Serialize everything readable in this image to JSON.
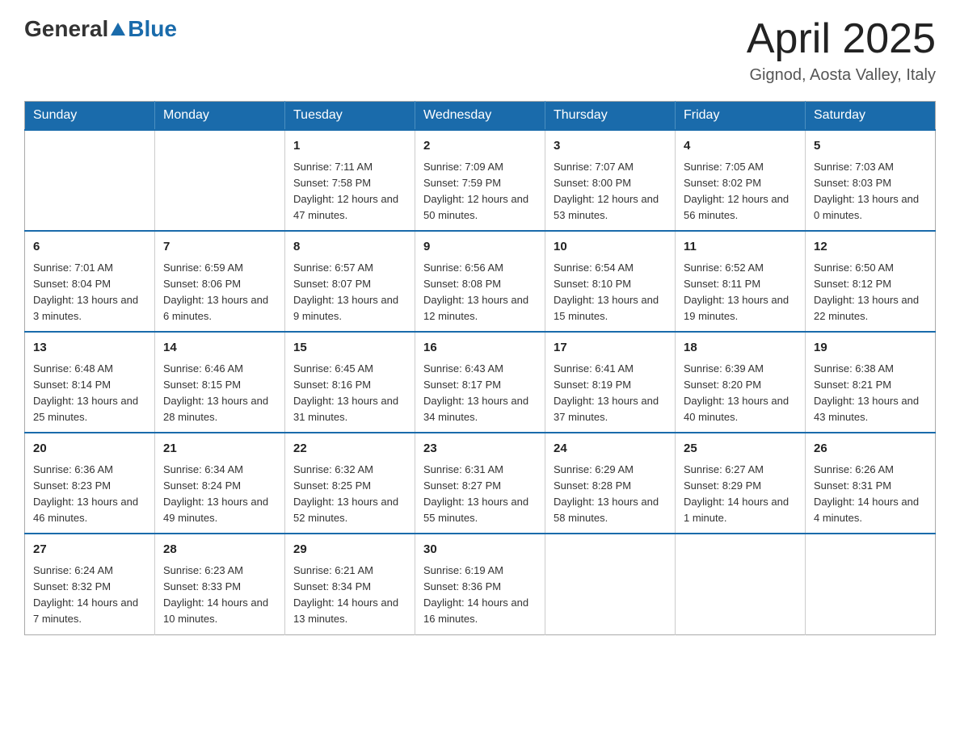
{
  "header": {
    "logo_general": "General",
    "logo_blue": "Blue",
    "title": "April 2025",
    "subtitle": "Gignod, Aosta Valley, Italy"
  },
  "days_of_week": [
    "Sunday",
    "Monday",
    "Tuesday",
    "Wednesday",
    "Thursday",
    "Friday",
    "Saturday"
  ],
  "weeks": [
    [
      {
        "day": "",
        "info": ""
      },
      {
        "day": "",
        "info": ""
      },
      {
        "day": "1",
        "info": "Sunrise: 7:11 AM\nSunset: 7:58 PM\nDaylight: 12 hours\nand 47 minutes."
      },
      {
        "day": "2",
        "info": "Sunrise: 7:09 AM\nSunset: 7:59 PM\nDaylight: 12 hours\nand 50 minutes."
      },
      {
        "day": "3",
        "info": "Sunrise: 7:07 AM\nSunset: 8:00 PM\nDaylight: 12 hours\nand 53 minutes."
      },
      {
        "day": "4",
        "info": "Sunrise: 7:05 AM\nSunset: 8:02 PM\nDaylight: 12 hours\nand 56 minutes."
      },
      {
        "day": "5",
        "info": "Sunrise: 7:03 AM\nSunset: 8:03 PM\nDaylight: 13 hours\nand 0 minutes."
      }
    ],
    [
      {
        "day": "6",
        "info": "Sunrise: 7:01 AM\nSunset: 8:04 PM\nDaylight: 13 hours\nand 3 minutes."
      },
      {
        "day": "7",
        "info": "Sunrise: 6:59 AM\nSunset: 8:06 PM\nDaylight: 13 hours\nand 6 minutes."
      },
      {
        "day": "8",
        "info": "Sunrise: 6:57 AM\nSunset: 8:07 PM\nDaylight: 13 hours\nand 9 minutes."
      },
      {
        "day": "9",
        "info": "Sunrise: 6:56 AM\nSunset: 8:08 PM\nDaylight: 13 hours\nand 12 minutes."
      },
      {
        "day": "10",
        "info": "Sunrise: 6:54 AM\nSunset: 8:10 PM\nDaylight: 13 hours\nand 15 minutes."
      },
      {
        "day": "11",
        "info": "Sunrise: 6:52 AM\nSunset: 8:11 PM\nDaylight: 13 hours\nand 19 minutes."
      },
      {
        "day": "12",
        "info": "Sunrise: 6:50 AM\nSunset: 8:12 PM\nDaylight: 13 hours\nand 22 minutes."
      }
    ],
    [
      {
        "day": "13",
        "info": "Sunrise: 6:48 AM\nSunset: 8:14 PM\nDaylight: 13 hours\nand 25 minutes."
      },
      {
        "day": "14",
        "info": "Sunrise: 6:46 AM\nSunset: 8:15 PM\nDaylight: 13 hours\nand 28 minutes."
      },
      {
        "day": "15",
        "info": "Sunrise: 6:45 AM\nSunset: 8:16 PM\nDaylight: 13 hours\nand 31 minutes."
      },
      {
        "day": "16",
        "info": "Sunrise: 6:43 AM\nSunset: 8:17 PM\nDaylight: 13 hours\nand 34 minutes."
      },
      {
        "day": "17",
        "info": "Sunrise: 6:41 AM\nSunset: 8:19 PM\nDaylight: 13 hours\nand 37 minutes."
      },
      {
        "day": "18",
        "info": "Sunrise: 6:39 AM\nSunset: 8:20 PM\nDaylight: 13 hours\nand 40 minutes."
      },
      {
        "day": "19",
        "info": "Sunrise: 6:38 AM\nSunset: 8:21 PM\nDaylight: 13 hours\nand 43 minutes."
      }
    ],
    [
      {
        "day": "20",
        "info": "Sunrise: 6:36 AM\nSunset: 8:23 PM\nDaylight: 13 hours\nand 46 minutes."
      },
      {
        "day": "21",
        "info": "Sunrise: 6:34 AM\nSunset: 8:24 PM\nDaylight: 13 hours\nand 49 minutes."
      },
      {
        "day": "22",
        "info": "Sunrise: 6:32 AM\nSunset: 8:25 PM\nDaylight: 13 hours\nand 52 minutes."
      },
      {
        "day": "23",
        "info": "Sunrise: 6:31 AM\nSunset: 8:27 PM\nDaylight: 13 hours\nand 55 minutes."
      },
      {
        "day": "24",
        "info": "Sunrise: 6:29 AM\nSunset: 8:28 PM\nDaylight: 13 hours\nand 58 minutes."
      },
      {
        "day": "25",
        "info": "Sunrise: 6:27 AM\nSunset: 8:29 PM\nDaylight: 14 hours\nand 1 minute."
      },
      {
        "day": "26",
        "info": "Sunrise: 6:26 AM\nSunset: 8:31 PM\nDaylight: 14 hours\nand 4 minutes."
      }
    ],
    [
      {
        "day": "27",
        "info": "Sunrise: 6:24 AM\nSunset: 8:32 PM\nDaylight: 14 hours\nand 7 minutes."
      },
      {
        "day": "28",
        "info": "Sunrise: 6:23 AM\nSunset: 8:33 PM\nDaylight: 14 hours\nand 10 minutes."
      },
      {
        "day": "29",
        "info": "Sunrise: 6:21 AM\nSunset: 8:34 PM\nDaylight: 14 hours\nand 13 minutes."
      },
      {
        "day": "30",
        "info": "Sunrise: 6:19 AM\nSunset: 8:36 PM\nDaylight: 14 hours\nand 16 minutes."
      },
      {
        "day": "",
        "info": ""
      },
      {
        "day": "",
        "info": ""
      },
      {
        "day": "",
        "info": ""
      }
    ]
  ]
}
